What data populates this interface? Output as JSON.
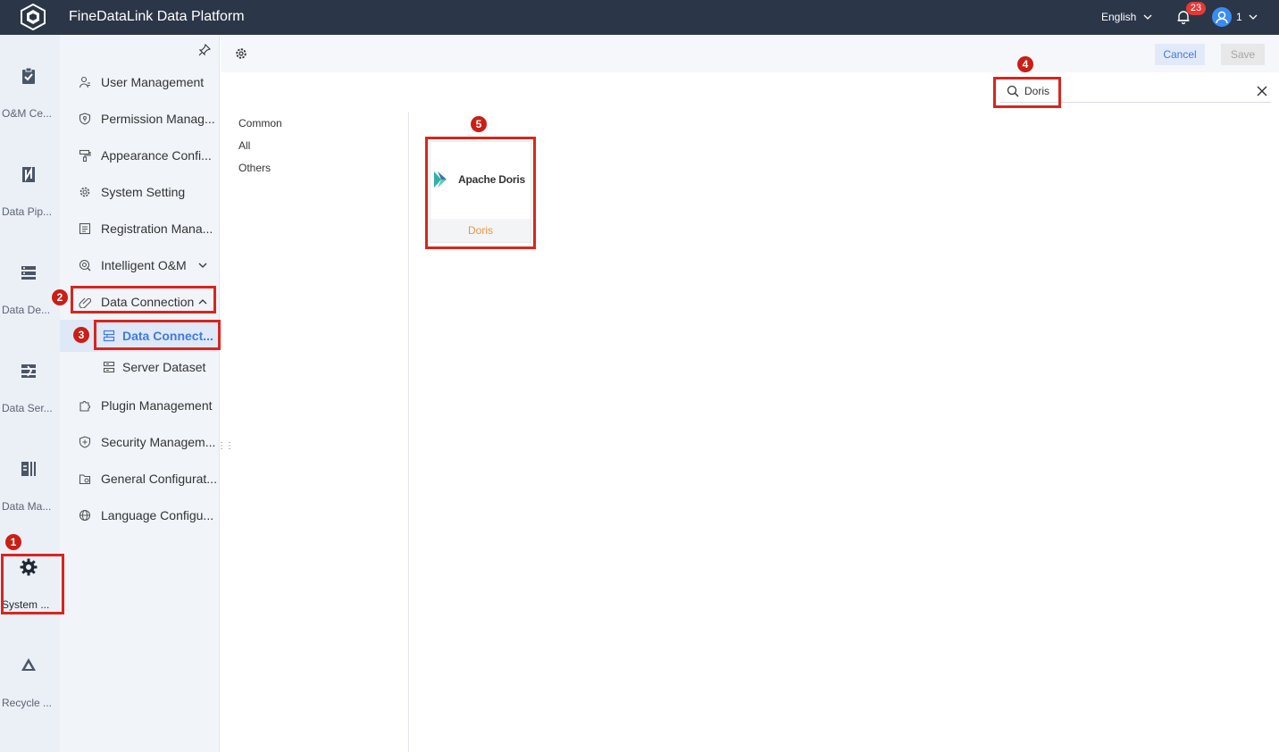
{
  "app": {
    "title": "FineDataLink Data Platform"
  },
  "topbar": {
    "language": "English",
    "notification_count": "23",
    "user": "1"
  },
  "rail": {
    "items": [
      {
        "label": "O&M Ce...",
        "icon": "clipboard-check-icon"
      },
      {
        "label": "Data Pip...",
        "icon": "pipeline-icon"
      },
      {
        "label": "Data De...",
        "icon": "database-layers-icon"
      },
      {
        "label": "Data Ser...",
        "icon": "service-icon"
      },
      {
        "label": "Data Ma...",
        "icon": "data-map-icon"
      },
      {
        "label": "System ...",
        "icon": "gear-icon"
      },
      {
        "label": "Recycle ...",
        "icon": "recycle-icon"
      }
    ]
  },
  "menu": {
    "items": [
      {
        "label": "User Management",
        "icon": "user-icon"
      },
      {
        "label": "Permission Manag...",
        "icon": "shield-icon"
      },
      {
        "label": "Appearance Confi...",
        "icon": "paint-roller-icon"
      },
      {
        "label": "System Setting",
        "icon": "gear-icon"
      },
      {
        "label": "Registration Mana...",
        "icon": "registration-icon"
      },
      {
        "label": "Intelligent O&M",
        "icon": "monitor-icon"
      },
      {
        "label": "Data Connection",
        "icon": "link-icon"
      },
      {
        "label": "Data Connect...",
        "icon": "connection-icon"
      },
      {
        "label": "Server Dataset",
        "icon": "dataset-icon"
      },
      {
        "label": "Plugin Management",
        "icon": "puzzle-icon"
      },
      {
        "label": "Security Managem...",
        "icon": "security-icon"
      },
      {
        "label": "General Configurat...",
        "icon": "folder-gear-icon"
      },
      {
        "label": "Language Configu...",
        "icon": "globe-icon"
      }
    ]
  },
  "toolbar": {
    "cancel_label": "Cancel",
    "save_label": "Save"
  },
  "search": {
    "value": "Doris"
  },
  "categories": [
    "Common",
    "All",
    "Others"
  ],
  "connector": {
    "logo_text": "Apache Doris",
    "label": "Doris"
  },
  "annotations": [
    "1",
    "2",
    "3",
    "4",
    "5"
  ],
  "colors": {
    "topbar": "#2b3648",
    "accent": "#3f7be0",
    "highlight": "#d7261e",
    "card_label": "#e8963a"
  }
}
